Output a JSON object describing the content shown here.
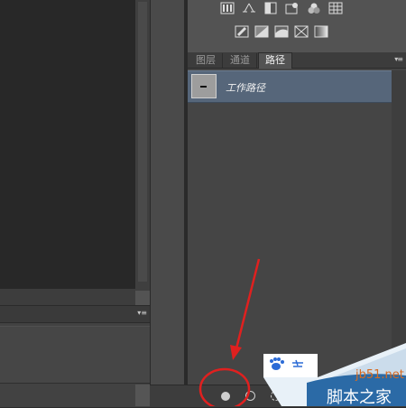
{
  "paths_panel": {
    "tabs": [
      {
        "label": "图层",
        "active": false
      },
      {
        "label": "通道",
        "active": false
      },
      {
        "label": "路径",
        "active": true
      }
    ],
    "menu_icon": "panel-menu-icon",
    "items": [
      {
        "name": "工作路径",
        "selected": true
      }
    ],
    "selection_color": "#56667a"
  },
  "adjustments_panel": {
    "row1_icons": [
      "levels-icon",
      "curves-icon",
      "exposure-icon",
      "hue-saturation-icon",
      "color-balance-icon",
      "color-lookup-icon"
    ],
    "row2_icons": [
      "invert-icon",
      "posterize-icon",
      "threshold-icon",
      "selective-color-icon",
      "gradient-map-icon"
    ]
  },
  "bottom_toolbar": {
    "buttons": [
      "fill-path-icon",
      "stroke-path-icon",
      "load-selection-icon"
    ]
  },
  "annotation": {
    "color": "#e0201f"
  },
  "watermark": {
    "site": "jb51.net",
    "brand": "脚本之家"
  }
}
